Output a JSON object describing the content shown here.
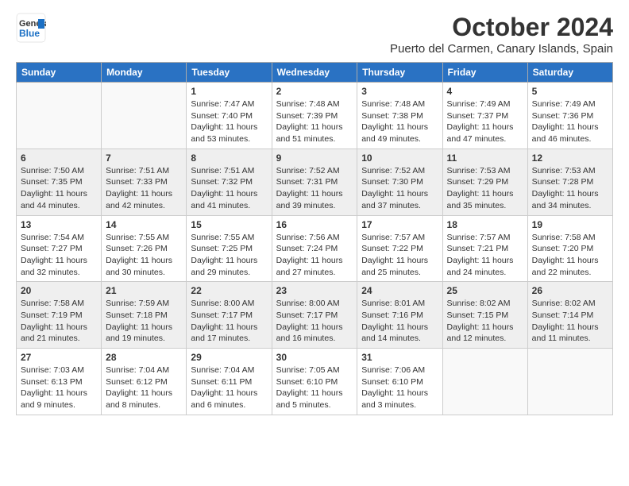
{
  "header": {
    "logo_general": "General",
    "logo_blue": "Blue",
    "month": "October 2024",
    "location": "Puerto del Carmen, Canary Islands, Spain"
  },
  "weekdays": [
    "Sunday",
    "Monday",
    "Tuesday",
    "Wednesday",
    "Thursday",
    "Friday",
    "Saturday"
  ],
  "weeks": [
    [
      {
        "day": "",
        "info": ""
      },
      {
        "day": "",
        "info": ""
      },
      {
        "day": "1",
        "info": "Sunrise: 7:47 AM\nSunset: 7:40 PM\nDaylight: 11 hours and 53 minutes."
      },
      {
        "day": "2",
        "info": "Sunrise: 7:48 AM\nSunset: 7:39 PM\nDaylight: 11 hours and 51 minutes."
      },
      {
        "day": "3",
        "info": "Sunrise: 7:48 AM\nSunset: 7:38 PM\nDaylight: 11 hours and 49 minutes."
      },
      {
        "day": "4",
        "info": "Sunrise: 7:49 AM\nSunset: 7:37 PM\nDaylight: 11 hours and 47 minutes."
      },
      {
        "day": "5",
        "info": "Sunrise: 7:49 AM\nSunset: 7:36 PM\nDaylight: 11 hours and 46 minutes."
      }
    ],
    [
      {
        "day": "6",
        "info": "Sunrise: 7:50 AM\nSunset: 7:35 PM\nDaylight: 11 hours and 44 minutes."
      },
      {
        "day": "7",
        "info": "Sunrise: 7:51 AM\nSunset: 7:33 PM\nDaylight: 11 hours and 42 minutes."
      },
      {
        "day": "8",
        "info": "Sunrise: 7:51 AM\nSunset: 7:32 PM\nDaylight: 11 hours and 41 minutes."
      },
      {
        "day": "9",
        "info": "Sunrise: 7:52 AM\nSunset: 7:31 PM\nDaylight: 11 hours and 39 minutes."
      },
      {
        "day": "10",
        "info": "Sunrise: 7:52 AM\nSunset: 7:30 PM\nDaylight: 11 hours and 37 minutes."
      },
      {
        "day": "11",
        "info": "Sunrise: 7:53 AM\nSunset: 7:29 PM\nDaylight: 11 hours and 35 minutes."
      },
      {
        "day": "12",
        "info": "Sunrise: 7:53 AM\nSunset: 7:28 PM\nDaylight: 11 hours and 34 minutes."
      }
    ],
    [
      {
        "day": "13",
        "info": "Sunrise: 7:54 AM\nSunset: 7:27 PM\nDaylight: 11 hours and 32 minutes."
      },
      {
        "day": "14",
        "info": "Sunrise: 7:55 AM\nSunset: 7:26 PM\nDaylight: 11 hours and 30 minutes."
      },
      {
        "day": "15",
        "info": "Sunrise: 7:55 AM\nSunset: 7:25 PM\nDaylight: 11 hours and 29 minutes."
      },
      {
        "day": "16",
        "info": "Sunrise: 7:56 AM\nSunset: 7:24 PM\nDaylight: 11 hours and 27 minutes."
      },
      {
        "day": "17",
        "info": "Sunrise: 7:57 AM\nSunset: 7:22 PM\nDaylight: 11 hours and 25 minutes."
      },
      {
        "day": "18",
        "info": "Sunrise: 7:57 AM\nSunset: 7:21 PM\nDaylight: 11 hours and 24 minutes."
      },
      {
        "day": "19",
        "info": "Sunrise: 7:58 AM\nSunset: 7:20 PM\nDaylight: 11 hours and 22 minutes."
      }
    ],
    [
      {
        "day": "20",
        "info": "Sunrise: 7:58 AM\nSunset: 7:19 PM\nDaylight: 11 hours and 21 minutes."
      },
      {
        "day": "21",
        "info": "Sunrise: 7:59 AM\nSunset: 7:18 PM\nDaylight: 11 hours and 19 minutes."
      },
      {
        "day": "22",
        "info": "Sunrise: 8:00 AM\nSunset: 7:17 PM\nDaylight: 11 hours and 17 minutes."
      },
      {
        "day": "23",
        "info": "Sunrise: 8:00 AM\nSunset: 7:17 PM\nDaylight: 11 hours and 16 minutes."
      },
      {
        "day": "24",
        "info": "Sunrise: 8:01 AM\nSunset: 7:16 PM\nDaylight: 11 hours and 14 minutes."
      },
      {
        "day": "25",
        "info": "Sunrise: 8:02 AM\nSunset: 7:15 PM\nDaylight: 11 hours and 12 minutes."
      },
      {
        "day": "26",
        "info": "Sunrise: 8:02 AM\nSunset: 7:14 PM\nDaylight: 11 hours and 11 minutes."
      }
    ],
    [
      {
        "day": "27",
        "info": "Sunrise: 7:03 AM\nSunset: 6:13 PM\nDaylight: 11 hours and 9 minutes."
      },
      {
        "day": "28",
        "info": "Sunrise: 7:04 AM\nSunset: 6:12 PM\nDaylight: 11 hours and 8 minutes."
      },
      {
        "day": "29",
        "info": "Sunrise: 7:04 AM\nSunset: 6:11 PM\nDaylight: 11 hours and 6 minutes."
      },
      {
        "day": "30",
        "info": "Sunrise: 7:05 AM\nSunset: 6:10 PM\nDaylight: 11 hours and 5 minutes."
      },
      {
        "day": "31",
        "info": "Sunrise: 7:06 AM\nSunset: 6:10 PM\nDaylight: 11 hours and 3 minutes."
      },
      {
        "day": "",
        "info": ""
      },
      {
        "day": "",
        "info": ""
      }
    ]
  ]
}
